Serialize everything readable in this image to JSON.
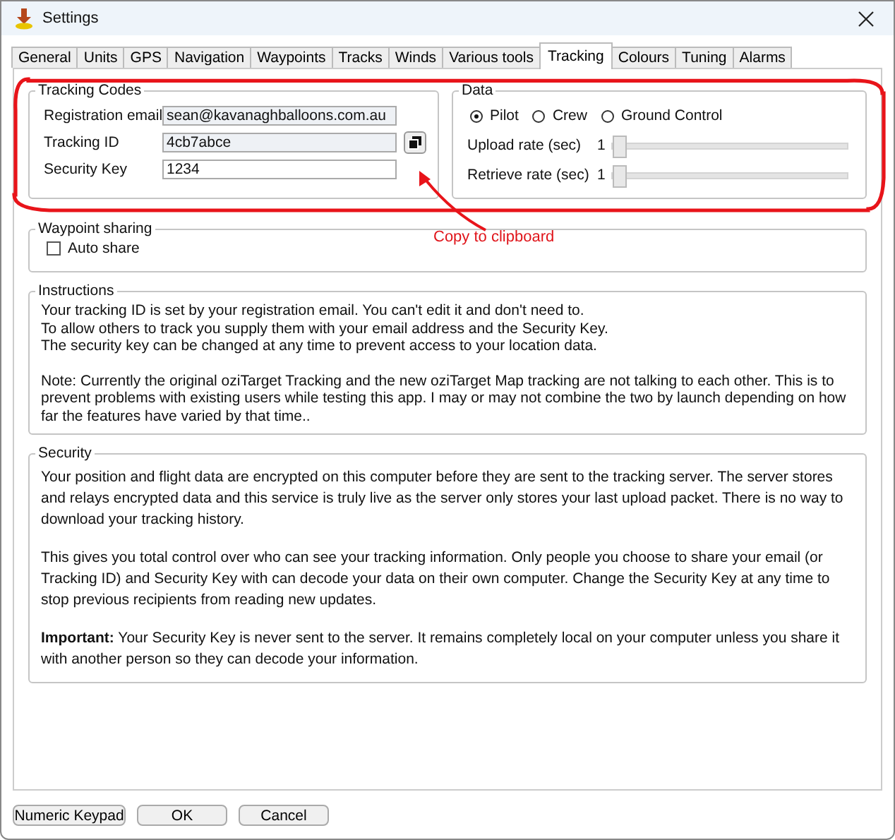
{
  "window": {
    "title": "Settings"
  },
  "tabs": [
    {
      "label": "General",
      "selected": false
    },
    {
      "label": "Units",
      "selected": false
    },
    {
      "label": "GPS",
      "selected": false
    },
    {
      "label": "Navigation",
      "selected": false
    },
    {
      "label": "Waypoints",
      "selected": false
    },
    {
      "label": "Tracks",
      "selected": false
    },
    {
      "label": "Winds",
      "selected": false
    },
    {
      "label": "Various tools",
      "selected": false
    },
    {
      "label": "Tracking",
      "selected": true
    },
    {
      "label": "Colours",
      "selected": false
    },
    {
      "label": "Tuning",
      "selected": false
    },
    {
      "label": "Alarms",
      "selected": false
    }
  ],
  "tracking_codes": {
    "title": "Tracking Codes",
    "fields": [
      {
        "label": "Registration email",
        "value": "sean@kavanaghballoons.com.au",
        "disabled": true,
        "kind": "text"
      },
      {
        "label": "Tracking ID",
        "value": "4cb7abce",
        "disabled": true,
        "kind": "copy"
      },
      {
        "label": "Security Key",
        "value": "1234",
        "disabled": false,
        "kind": "text"
      }
    ]
  },
  "data": {
    "title": "Data",
    "roles": [
      {
        "label": "Pilot",
        "selected": true
      },
      {
        "label": "Crew",
        "selected": false
      },
      {
        "label": "Ground Control",
        "selected": false
      }
    ],
    "rates": [
      {
        "label": "Upload rate (sec)",
        "reading": "1",
        "level": 0
      },
      {
        "label": "Retrieve rate (sec)",
        "reading": "1",
        "level": 0
      }
    ]
  },
  "waypoint_sharing": {
    "title": "Waypoint sharing",
    "auto_share": {
      "label": "Auto share",
      "checked": false
    }
  },
  "instructions": {
    "title": "Instructions",
    "paragraphs": [
      [
        "Your tracking ID is set by your registration email.  You can't edit it and don't need to.",
        "To allow others to track you supply them with your email address and the Security Key.",
        "The security key can be changed at any time to prevent access to your location data."
      ],
      [
        "Note: Currently the original oziTarget Tracking and the new oziTarget Map tracking are not talking to each other.  This is to prevent problems with existing users while testing this app.  I may or may not combine the two by launch depending on how far the features have varied by that time.."
      ]
    ]
  },
  "security": {
    "title": "Security",
    "paragraphs": [
      "Your position and flight data are encrypted on this computer before they are sent to the tracking server. The server stores and relays encrypted data and this service is truly live as the server only stores your last upload packet. There is no way to download your tracking history.",
      "This gives you total control over who can see your tracking information. Only people you choose to share your email (or Tracking ID) and Security Key with can decode your data on their own computer. Change the Security Key at any time to stop previous recipients from reading new updates.",
      "**Important:**  Your Security Key is never sent to the server. It remains completely local on your computer unless you share it with another person so they can decode your information."
    ]
  },
  "buttons": [
    "Numeric Keypad",
    "OK",
    "Cancel"
  ],
  "annotation": {
    "text": "Copy to clipboard"
  }
}
